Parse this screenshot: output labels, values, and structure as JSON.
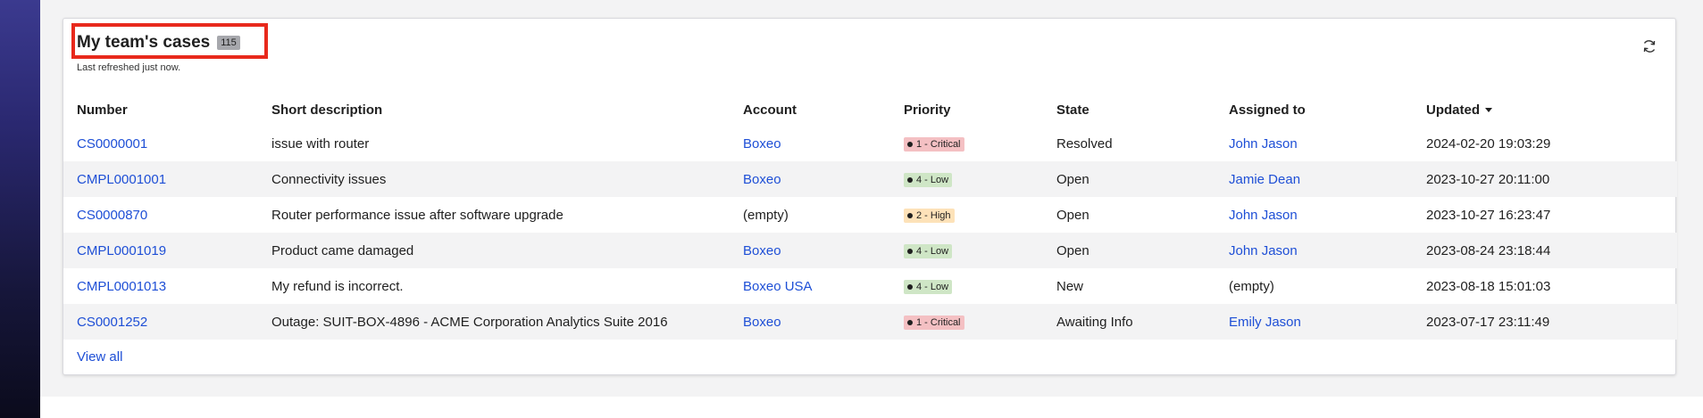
{
  "card": {
    "title": "My team's cases",
    "count": "115",
    "refreshed": "Last refreshed just now.",
    "view_all": "View all"
  },
  "table": {
    "columns": [
      "Number",
      "Short description",
      "Account",
      "Priority",
      "State",
      "Assigned to",
      "Updated"
    ],
    "rows": [
      {
        "number": "CS0000001",
        "description": "issue with router",
        "account": "Boxeo",
        "account_link": true,
        "priority": "1 - Critical",
        "priority_color": "#f4c0c3",
        "state": "Resolved",
        "assigned": "John Jason",
        "assigned_link": true,
        "updated": "2024-02-20 19:03:29"
      },
      {
        "number": "CMPL0001001",
        "description": "Connectivity issues",
        "account": "Boxeo",
        "account_link": true,
        "priority": "4 - Low",
        "priority_color": "#cfe6c6",
        "state": "Open",
        "assigned": "Jamie Dean",
        "assigned_link": true,
        "updated": "2023-10-27 20:11:00"
      },
      {
        "number": "CS0000870",
        "description": "Router performance issue after software upgrade",
        "account": "(empty)",
        "account_link": false,
        "priority": "2 - High",
        "priority_color": "#fde2b9",
        "state": "Open",
        "assigned": "John Jason",
        "assigned_link": true,
        "updated": "2023-10-27 16:23:47"
      },
      {
        "number": "CMPL0001019",
        "description": "Product came damaged",
        "account": "Boxeo",
        "account_link": true,
        "priority": "4 - Low",
        "priority_color": "#cfe6c6",
        "state": "Open",
        "assigned": "John Jason",
        "assigned_link": true,
        "updated": "2023-08-24 23:18:44"
      },
      {
        "number": "CMPL0001013",
        "description": "My refund is incorrect.",
        "account": "Boxeo USA",
        "account_link": true,
        "priority": "4 - Low",
        "priority_color": "#cfe6c6",
        "state": "New",
        "assigned": "(empty)",
        "assigned_link": false,
        "updated": "2023-08-18 15:01:03"
      },
      {
        "number": "CS0001252",
        "description": "Outage: SUIT-BOX-4896 - ACME Corporation Analytics Suite 2016",
        "account": "Boxeo",
        "account_link": true,
        "priority": "1 - Critical",
        "priority_color": "#f4c0c3",
        "state": "Awaiting Info",
        "assigned": "Emily Jason",
        "assigned_link": true,
        "updated": "2023-07-17 23:11:49"
      }
    ]
  },
  "icons": {
    "refresh": "refresh-icon",
    "sort": "sort-descending-icon"
  },
  "colors": {
    "link": "#1e4fd6",
    "highlight_border": "#e8291c"
  }
}
